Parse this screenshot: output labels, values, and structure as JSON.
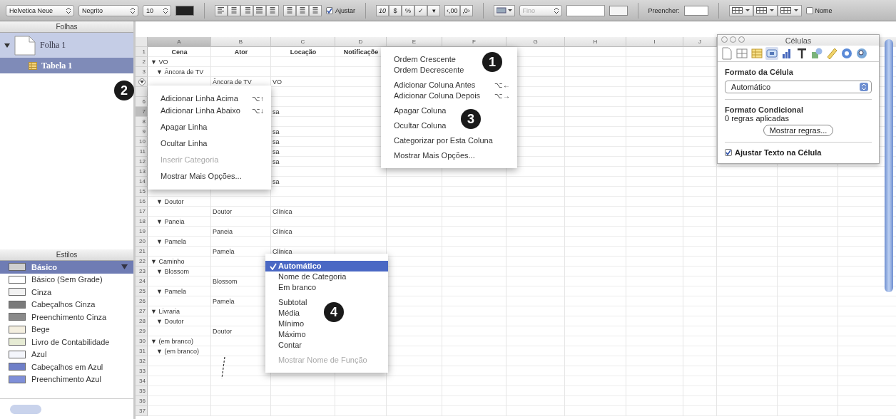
{
  "toolbar": {
    "font": "Helvetica Neue",
    "style": "Negrito",
    "size": "10",
    "wrap": {
      "label": "Ajustar",
      "checked": true
    },
    "format_buttons": [
      "10",
      "$",
      "%",
      "✓",
      "▾",
      "‹,00",
      ",0›"
    ],
    "line_style": {
      "value": "Fino",
      "disabled": true
    },
    "fill_label": "Preencher:",
    "name_checkbox": {
      "label": "Nome",
      "checked": false
    }
  },
  "sidebar": {
    "sheets_header": "Folhas",
    "sheets": [
      {
        "label": "Folha 1",
        "selected": false,
        "expanded": true,
        "children": [
          {
            "label": "Tabela 1",
            "selected": true
          }
        ]
      }
    ],
    "styles_header": "Estilos",
    "styles": [
      {
        "label": "Básico",
        "selected": true,
        "color": "#cfcfcf"
      },
      {
        "label": "Básico (Sem Grade)",
        "selected": false,
        "color": "#ffffff"
      },
      {
        "label": "Cinza",
        "selected": false,
        "color": "#f2f2f2"
      },
      {
        "label": "Cabeçalhos Cinza",
        "selected": false,
        "color": "#7a7a7a"
      },
      {
        "label": "Preenchimento Cinza",
        "selected": false,
        "color": "#8a8a8a"
      },
      {
        "label": "Bege",
        "selected": false,
        "color": "#f4efe0"
      },
      {
        "label": "Livro de Contabilidade",
        "selected": false,
        "color": "#e6ebd4"
      },
      {
        "label": "Azul",
        "selected": false,
        "color": "#f4f6fc"
      },
      {
        "label": "Cabeçalhos em Azul",
        "selected": false,
        "color": "#6f7fc8"
      },
      {
        "label": "Preenchimento Azul",
        "selected": false,
        "color": "#7f8fd8"
      }
    ]
  },
  "table": {
    "columns": [
      {
        "label": "A",
        "selected": true
      },
      {
        "label": "B",
        "selected": false
      },
      {
        "label": "C",
        "selected": false
      },
      {
        "label": "D",
        "selected": false
      },
      {
        "label": "E",
        "selected": false
      },
      {
        "label": "F",
        "selected": false
      },
      {
        "label": "G",
        "selected": false
      },
      {
        "label": "H",
        "selected": false
      },
      {
        "label": "I",
        "selected": false
      },
      {
        "label": "J",
        "selected": false
      }
    ],
    "rows": [
      {
        "number": "1",
        "kind": "header",
        "selected": false,
        "handle": false,
        "a": "Cena",
        "b": "Ator",
        "c": "Locação",
        "d": "Notificaçõe"
      },
      {
        "number": "2",
        "kind": "group",
        "selected": false,
        "handle": false,
        "a": "▼ VO"
      },
      {
        "number": "3",
        "kind": "subgroup",
        "selected": false,
        "handle": false,
        "a": "▼ Âncora de TV"
      },
      {
        "kind": "data",
        "selected": false,
        "handle": true,
        "b": "Âncora de TV",
        "c": "VO"
      },
      {
        "kind": "data",
        "selected": false,
        "handle": false
      },
      {
        "number": "6",
        "kind": "data",
        "selected": false,
        "handle": false
      },
      {
        "number": "7",
        "kind": "data",
        "selected": true,
        "handle": false,
        "c": "sa"
      },
      {
        "number": "8",
        "kind": "data",
        "selected": false,
        "handle": false
      },
      {
        "number": "9",
        "kind": "data",
        "selected": false,
        "handle": false,
        "c": "sa"
      },
      {
        "number": "10",
        "kind": "data",
        "selected": false,
        "handle": false,
        "c": "sa"
      },
      {
        "number": "11",
        "kind": "data",
        "selected": false,
        "handle": false,
        "c": "sa"
      },
      {
        "number": "12",
        "kind": "data",
        "selected": false,
        "handle": false,
        "c": "sa"
      },
      {
        "number": "13",
        "kind": "data",
        "selected": false,
        "handle": false
      },
      {
        "number": "14",
        "kind": "data",
        "selected": false,
        "handle": false,
        "c": "sa"
      },
      {
        "number": "15",
        "kind": "data",
        "selected": false,
        "handle": false
      },
      {
        "number": "16",
        "kind": "subgroup",
        "selected": false,
        "handle": false,
        "a": "▼ Doutor"
      },
      {
        "number": "17",
        "kind": "data",
        "selected": false,
        "handle": false,
        "b": "Doutor",
        "c": "Clínica"
      },
      {
        "number": "18",
        "kind": "subgroup",
        "selected": false,
        "handle": false,
        "a": "▼ Paneia"
      },
      {
        "number": "19",
        "kind": "data",
        "selected": false,
        "handle": false,
        "b": "Paneia",
        "c": "Clínica"
      },
      {
        "number": "20",
        "kind": "subgroup",
        "selected": false,
        "handle": false,
        "a": "▼ Pamela"
      },
      {
        "number": "21",
        "kind": "data",
        "selected": false,
        "handle": false,
        "b": "Pamela",
        "c": "Clínica"
      },
      {
        "number": "22",
        "kind": "group",
        "selected": false,
        "handle": false,
        "a": "▼ Caminho"
      },
      {
        "number": "23",
        "kind": "subgroup",
        "selected": false,
        "handle": false,
        "a": "▼ Blossom"
      },
      {
        "number": "24",
        "kind": "data",
        "selected": false,
        "handle": false,
        "b": "Blossom"
      },
      {
        "number": "25",
        "kind": "subgroup",
        "selected": false,
        "handle": false,
        "a": "▼ Pamela"
      },
      {
        "number": "26",
        "kind": "data",
        "selected": false,
        "handle": false,
        "b": "Pamela"
      },
      {
        "number": "27",
        "kind": "group",
        "selected": false,
        "handle": false,
        "a": "▼ Livraria"
      },
      {
        "number": "28",
        "kind": "subgroup",
        "selected": false,
        "handle": false,
        "a": "▼ Doutor"
      },
      {
        "number": "29",
        "kind": "data",
        "selected": false,
        "handle": false,
        "b": "Doutor"
      },
      {
        "number": "30",
        "kind": "group",
        "selected": false,
        "handle": false,
        "a": "▼ (em branco)"
      },
      {
        "number": "31",
        "kind": "subgroup",
        "selected": false,
        "handle": false,
        "a": "▼ (em branco)"
      },
      {
        "number": "32",
        "kind": "data",
        "selected": false,
        "handle": false
      },
      {
        "number": "33",
        "kind": "data",
        "selected": false,
        "handle": false
      },
      {
        "number": "34",
        "kind": "data",
        "selected": false,
        "handle": false
      },
      {
        "number": "35",
        "kind": "data",
        "selected": false,
        "handle": false
      },
      {
        "number": "36",
        "kind": "data",
        "selected": false,
        "handle": false
      },
      {
        "number": "37",
        "kind": "data",
        "selected": false,
        "handle": false
      }
    ]
  },
  "column_menu": {
    "groups": [
      [
        {
          "label": "Ordem Crescente",
          "disabled": false
        },
        {
          "label": "Ordem Decrescente",
          "disabled": false
        }
      ],
      [
        {
          "label": "Adicionar Coluna Antes",
          "shortcut": "⌥←",
          "disabled": false
        },
        {
          "label": "Adicionar Coluna Depois",
          "shortcut": "⌥→",
          "disabled": false
        }
      ],
      [
        {
          "label": "Apagar Coluna",
          "disabled": false
        }
      ],
      [
        {
          "label": "Ocultar Coluna",
          "disabled": false
        }
      ],
      [
        {
          "label": "Categorizar por Esta Coluna",
          "disabled": false
        }
      ],
      [
        {
          "label": "Mostrar Mais Opções...",
          "disabled": false
        }
      ]
    ]
  },
  "row_menu": {
    "groups": [
      [
        {
          "label": "Adicionar Linha Acima",
          "shortcut": "⌥↑",
          "disabled": false
        },
        {
          "label": "Adicionar Linha Abaixo",
          "shortcut": "⌥↓",
          "disabled": false
        }
      ],
      [
        {
          "label": "Apagar Linha",
          "disabled": false
        }
      ],
      [
        {
          "label": "Ocultar Linha",
          "disabled": false
        }
      ],
      [
        {
          "label": "Inserir Categoria",
          "disabled": true
        }
      ],
      [
        {
          "label": "Mostrar Mais Opções...",
          "disabled": false
        }
      ]
    ]
  },
  "function_menu": {
    "groups": [
      [
        {
          "label": "Automático",
          "selected": true,
          "disabled": false
        },
        {
          "label": "Nome de Categoria",
          "selected": false,
          "disabled": false
        },
        {
          "label": "Em branco",
          "selected": false,
          "disabled": false
        }
      ],
      [
        {
          "label": "Subtotal",
          "selected": false,
          "disabled": false
        },
        {
          "label": "Média",
          "selected": false,
          "disabled": false
        },
        {
          "label": "Mínimo",
          "selected": false,
          "disabled": false
        },
        {
          "label": "Máximo",
          "selected": false,
          "disabled": false
        },
        {
          "label": "Contar",
          "selected": false,
          "disabled": false
        }
      ],
      [
        {
          "label": "Mostrar Nome de Função",
          "selected": false,
          "disabled": true
        }
      ]
    ]
  },
  "callouts": [
    "1",
    "2",
    "3",
    "4"
  ],
  "inspector": {
    "title": "Células",
    "tool_tabs": [
      {
        "selected": false
      },
      {
        "selected": false
      },
      {
        "selected": false
      },
      {
        "selected": true
      },
      {
        "selected": false
      },
      {
        "selected": false
      },
      {
        "selected": false
      },
      {
        "selected": false
      },
      {
        "selected": false
      },
      {
        "selected": false
      }
    ],
    "cell_format_label": "Formato da Célula",
    "cell_format": "Automático",
    "conditional_label": "Formato Condicional",
    "rules_text": "0 regras aplicadas",
    "rules_button": "Mostrar regras...",
    "wrap": {
      "label": "Ajustar Texto na Célula",
      "checked": true
    }
  }
}
